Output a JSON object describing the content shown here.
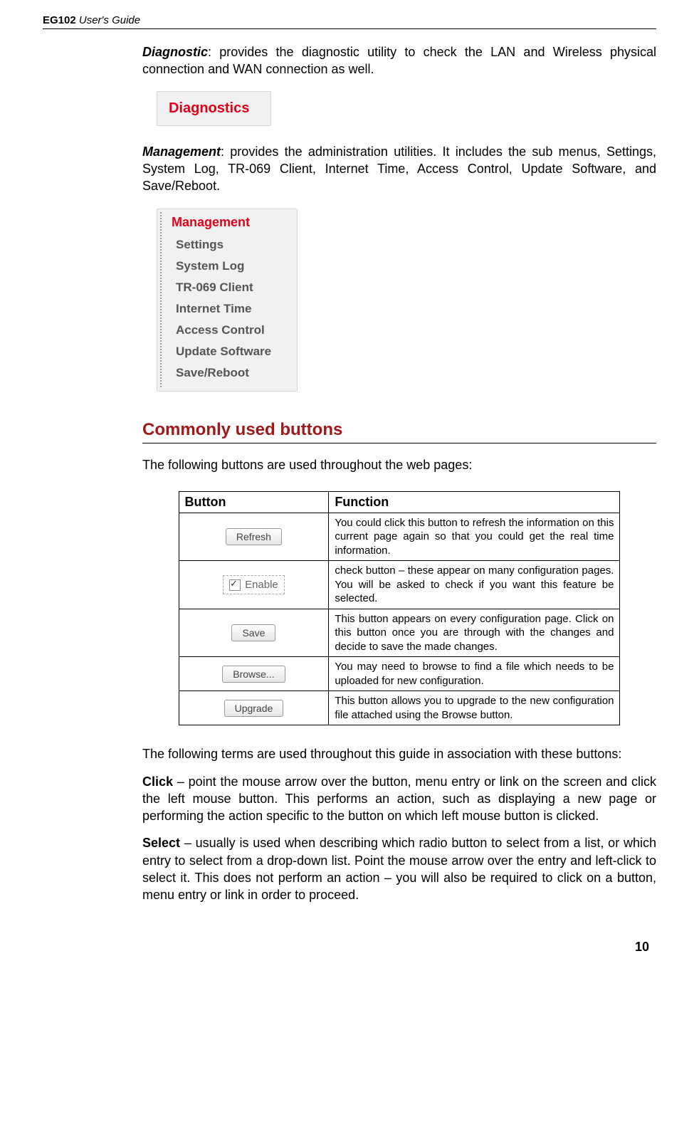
{
  "header": {
    "product": "EG102",
    "suffix": " User's Guide"
  },
  "diagnostic": {
    "label": "Diagnostic",
    "text": ": provides the diagnostic utility to check the LAN and Wireless physical connection and WAN connection as well.",
    "box_title": "Diagnostics"
  },
  "management": {
    "label": "Management",
    "text": ": provides the administration utilities. It includes the sub menus, Settings, System Log, TR-069 Client, Internet Time, Access Control, Update Software, and Save/Reboot.",
    "box_title": "Management",
    "items": [
      "Settings",
      "System Log",
      "TR-069 Client",
      "Internet Time",
      "Access Control",
      "Update Software",
      "Save/Reboot"
    ]
  },
  "section": {
    "title": "Commonly used buttons",
    "intro": "The following buttons are used throughout the web pages:"
  },
  "table": {
    "col_button": "Button",
    "col_function": "Function",
    "rows": [
      {
        "btn_label": "Refresh",
        "btn_type": "button",
        "func": "You could click this button to refresh the information on this current page again so that you could get the real time information."
      },
      {
        "btn_label": "Enable",
        "btn_type": "check",
        "func": "check button – these appear on many configuration pages. You will be asked to check if you want this feature be selected."
      },
      {
        "btn_label": "Save",
        "btn_type": "button",
        "func": "This button appears on every configuration page. Click on this button once you are through with the changes and decide to save the made changes."
      },
      {
        "btn_label": "Browse...",
        "btn_type": "button",
        "func": "You may need to browse to find a file which needs to be uploaded for new configuration."
      },
      {
        "btn_label": "Upgrade",
        "btn_type": "button",
        "func": "This button allows you to upgrade to the new configuration file attached using the Browse button."
      }
    ]
  },
  "terms": {
    "intro": "The following terms are used throughout this guide in association with these buttons:",
    "click_label": "Click",
    "click_text": " – point the mouse arrow over the button, menu entry or link on the screen and click the left mouse button. This performs an action, such as displaying a new page or performing the action specific to the button on which left mouse button is clicked.",
    "select_label": "Select",
    "select_text": " – usually is used when describing which radio button to select from a list, or which entry to select from a drop-down list. Point the mouse arrow over the entry and left-click to select it. This does not perform an action – you will also be required to click on a button, menu entry or link in order to proceed."
  },
  "page_number": "10"
}
